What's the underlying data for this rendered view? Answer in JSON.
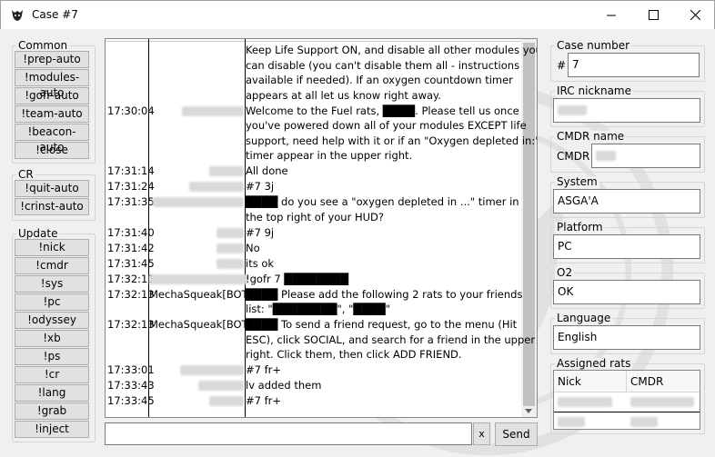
{
  "window": {
    "title": "Case #7"
  },
  "groups": {
    "common": {
      "label": "Common",
      "buttons": [
        "!prep-auto",
        "!modules-auto",
        "!gofr-auto",
        "!team-auto",
        "!beacon-auto",
        "!close"
      ]
    },
    "cr": {
      "label": "CR",
      "buttons": [
        "!quit-auto",
        "!crinst-auto"
      ]
    },
    "update": {
      "label": "Update",
      "buttons": [
        "!nick",
        "!cmdr",
        "!sys",
        "!pc",
        "!odyssey",
        "!xb",
        "!ps",
        "!cr",
        "!lang",
        "!grab",
        "!inject"
      ]
    }
  },
  "chat": {
    "messages": [
      {
        "time": "",
        "nick": "",
        "lines": [
          "Keep Life Support ON, and disable all other modules you",
          "can disable (you can't disable them all - instructions",
          "available if needed). If an oxygen countdown timer",
          "appears at all let us know right away."
        ]
      },
      {
        "time": "17:30:04",
        "nick": "",
        "lines": [
          "Welcome to the Fuel rats, ████. Please tell us once",
          "you've powered down all of your modules EXCEPT life",
          "support, need help with it or if an \"Oxygen depleted in:\"",
          "timer appear in the upper right."
        ]
      },
      {
        "time": "17:31:14",
        "nick": "",
        "lines": [
          "All done"
        ]
      },
      {
        "time": "17:31:24",
        "nick": "",
        "lines": [
          "#7 3j"
        ]
      },
      {
        "time": "17:31:35",
        "nick": "",
        "lines": [
          "████ do you see a \"oxygen depleted in ...\" timer in",
          "the top right of your HUD?"
        ]
      },
      {
        "time": "17:31:40",
        "nick": "",
        "lines": [
          "#7 9j"
        ]
      },
      {
        "time": "17:31:42",
        "nick": "",
        "lines": [
          "No"
        ]
      },
      {
        "time": "17:31:45",
        "nick": "",
        "lines": [
          "its ok"
        ]
      },
      {
        "time": "17:32:11",
        "nick": "",
        "lines": [
          "!gofr 7 ████████"
        ]
      },
      {
        "time": "17:32:13",
        "nick": "MechaSqueak[BOT]",
        "lines": [
          "████ Please add the following 2 rats to your friends",
          "list: \"████████\", \"████\""
        ]
      },
      {
        "time": "17:32:13",
        "nick": "MechaSqueak[BOT]",
        "lines": [
          "████ To send a friend request, go to the menu (Hit",
          "ESC), click SOCIAL, and search for a friend in the upper",
          "right. Click them, then click ADD FRIEND."
        ]
      },
      {
        "time": "17:33:01",
        "nick": "",
        "lines": [
          "#7 fr+"
        ]
      },
      {
        "time": "17:33:43",
        "nick": "",
        "lines": [
          "lv added them"
        ]
      },
      {
        "time": "17:33:45",
        "nick": "",
        "lines": [
          "#7 fr+"
        ]
      }
    ]
  },
  "input": {
    "value": "",
    "clear_label": "x",
    "send_label": "Send"
  },
  "right": {
    "case_number": {
      "label": "Case number",
      "prefix": "#",
      "value": "7"
    },
    "irc_nickname": {
      "label": "IRC nickname",
      "value": ""
    },
    "cmdr_name": {
      "label": "CMDR name",
      "prefix": "CMDR",
      "value": ""
    },
    "system": {
      "label": "System",
      "value": "ASGA'A"
    },
    "platform": {
      "label": "Platform",
      "value": "PC"
    },
    "o2": {
      "label": "O2",
      "value": "OK"
    },
    "language": {
      "label": "Language",
      "value": "English"
    },
    "assigned_rats": {
      "label": "Assigned rats",
      "columns": [
        "Nick",
        "CMDR"
      ],
      "rows": [
        [
          "",
          ""
        ],
        [
          "",
          ""
        ]
      ]
    }
  }
}
